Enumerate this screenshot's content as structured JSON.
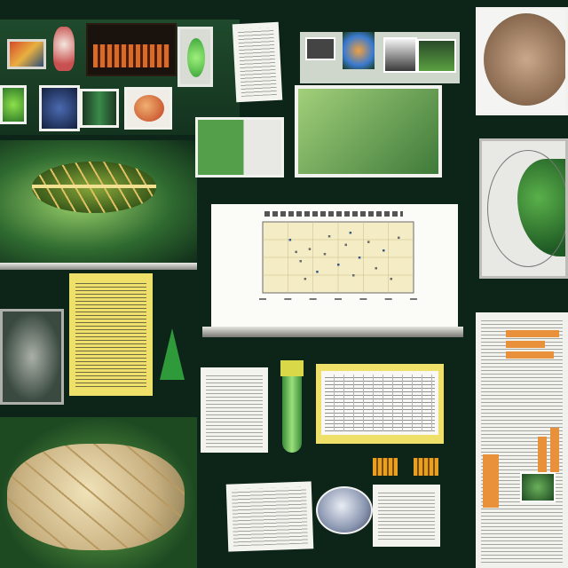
{
  "chart_data": {
    "type": "scatter",
    "title": "",
    "xlabel": "",
    "ylabel": "",
    "points": [
      [
        0.18,
        0.75
      ],
      [
        0.25,
        0.45
      ],
      [
        0.31,
        0.62
      ],
      [
        0.36,
        0.3
      ],
      [
        0.41,
        0.55
      ],
      [
        0.44,
        0.8
      ],
      [
        0.5,
        0.4
      ],
      [
        0.55,
        0.68
      ],
      [
        0.6,
        0.25
      ],
      [
        0.64,
        0.5
      ],
      [
        0.7,
        0.72
      ],
      [
        0.75,
        0.35
      ],
      [
        0.8,
        0.6
      ],
      [
        0.85,
        0.2
      ],
      [
        0.28,
        0.2
      ],
      [
        0.58,
        0.85
      ],
      [
        0.9,
        0.78
      ],
      [
        0.22,
        0.58
      ]
    ]
  },
  "colors": {
    "background": "#0d2418",
    "panel_green": "#2e6a35",
    "accent_yellow": "#efe06a",
    "accent_orange": "#e8913a"
  }
}
